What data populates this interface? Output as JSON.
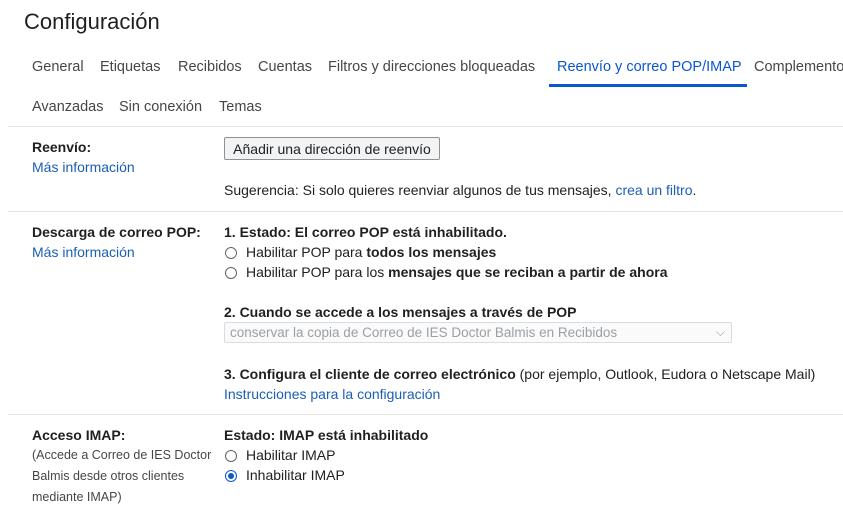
{
  "page": {
    "title": "Configuración"
  },
  "tabs": [
    {
      "label": "General"
    },
    {
      "label": "Etiquetas"
    },
    {
      "label": "Recibidos"
    },
    {
      "label": "Cuentas"
    },
    {
      "label": "Filtros y direcciones bloqueadas"
    },
    {
      "label": "Reenvío y correo POP/IMAP",
      "active": true
    },
    {
      "label": "Complementos"
    },
    {
      "label": "Avanzadas"
    },
    {
      "label": "Sin conexión"
    },
    {
      "label": "Temas"
    }
  ],
  "forwarding": {
    "label": "Reenvío:",
    "more_info": "Más información",
    "add_button": "Añadir una dirección de reenvío",
    "tip_text": "Sugerencia: Si solo quieres reenviar algunos de tus mensajes,",
    "tip_link": "crea un filtro",
    "tip_end": "."
  },
  "pop": {
    "label": "Descarga de correo POP:",
    "more_info": "Más información",
    "status": "1. Estado: El correo POP está inhabilitado.",
    "option1_prefix": "Habilitar POP para ",
    "option1_bold": "todos los mensajes",
    "option2_prefix": "Habilitar POP para los ",
    "option2_bold": "mensajes que se reciban a partir de ahora",
    "when_accessed": "2. Cuando se accede a los mensajes a través de POP",
    "select_value": "conservar la copia de Correo de IES Doctor Balmis en Recibidos",
    "configure_bold": "3. Configura el cliente de correo electrónico",
    "configure_rest": " (por ejemplo, Outlook, Eudora o Netscape Mail)",
    "instructions_link": "Instrucciones para la configuración"
  },
  "imap": {
    "label": "Acceso IMAP:",
    "desc_line1": "(Accede a Correo de IES Doctor",
    "desc_line2": "Balmis desde otros clientes",
    "desc_line3": "mediante IMAP)",
    "status": "Estado: IMAP está inhabilitado",
    "enable": "Habilitar IMAP",
    "disable": "Inhabilitar IMAP",
    "selected": "disable"
  },
  "colors": {
    "accent": "#0b57d0",
    "link": "#1a5fb4",
    "divider": "#e5e5e5"
  }
}
